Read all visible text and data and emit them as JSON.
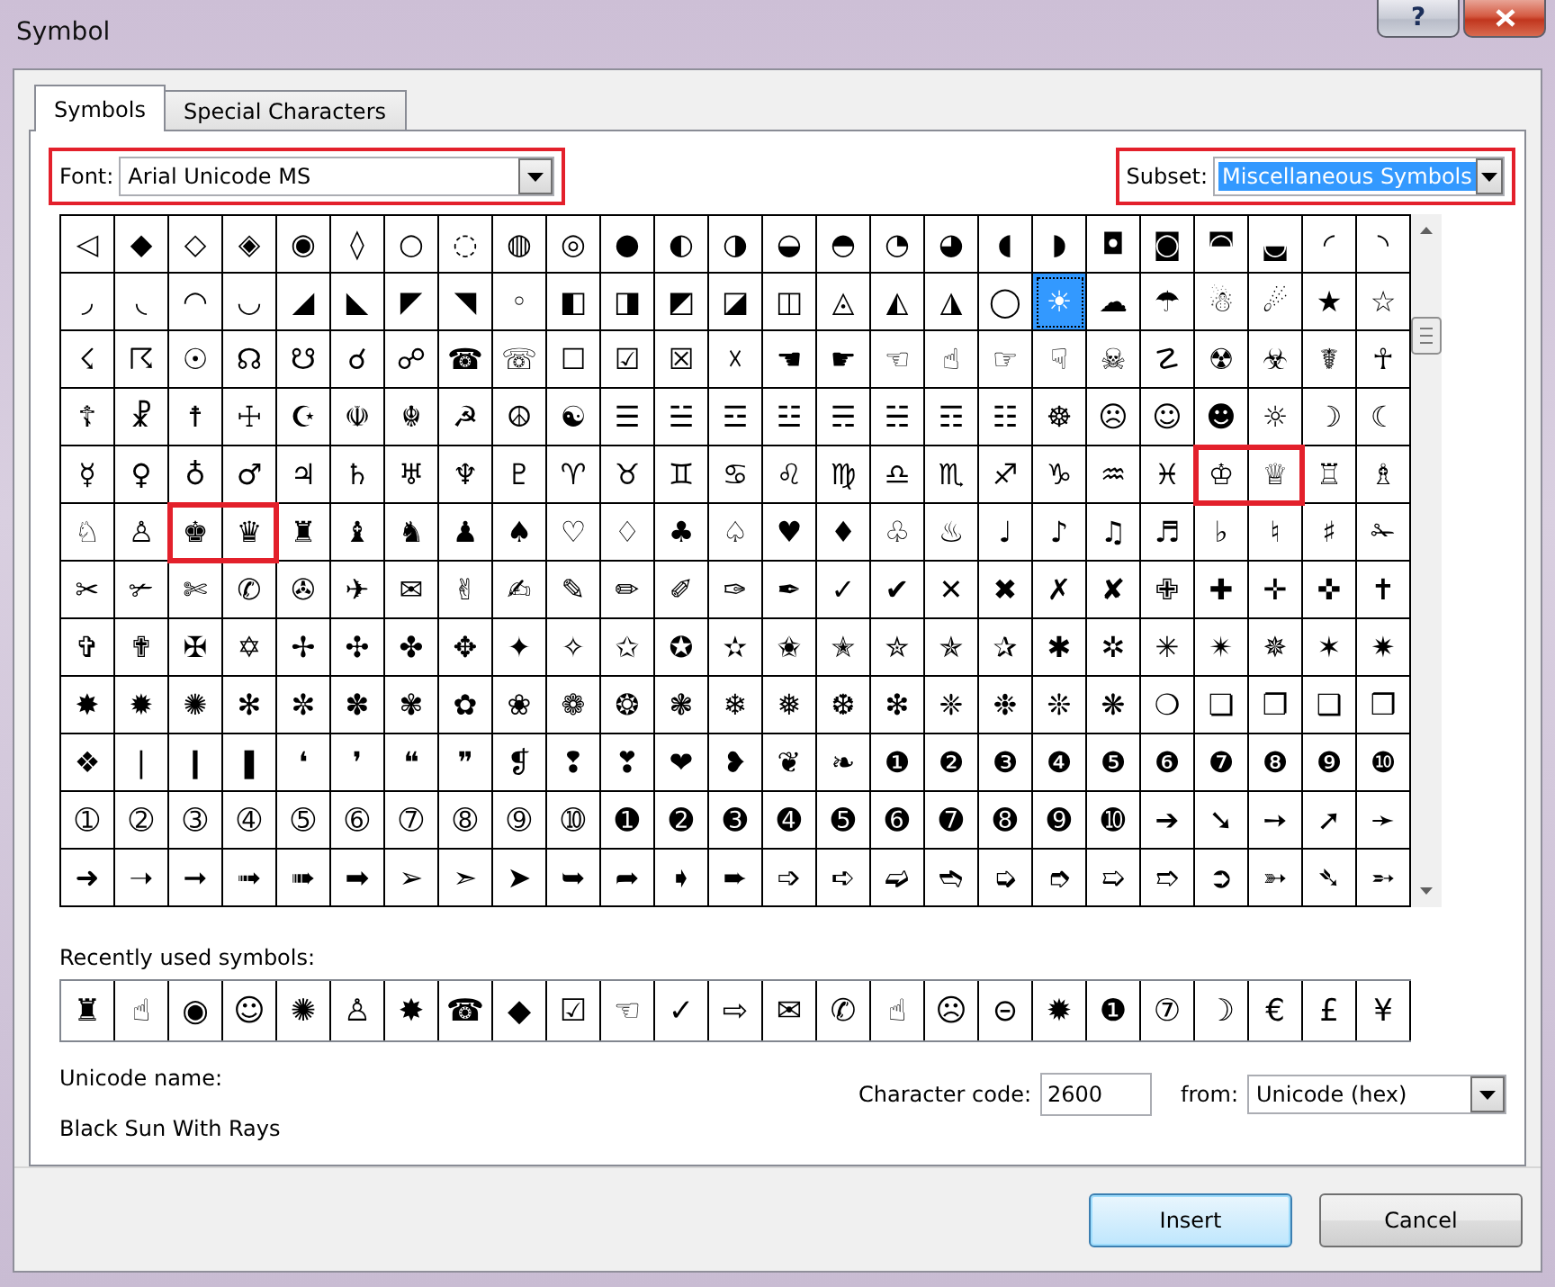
{
  "window": {
    "title": "Symbol",
    "help_button": "?"
  },
  "tabs": [
    {
      "label": "Symbols",
      "selected": true
    },
    {
      "label": "Special Characters",
      "selected": false
    }
  ],
  "font": {
    "label": "Font:",
    "value": "Arial Unicode MS",
    "highlighted": true
  },
  "subset": {
    "label": "Subset:",
    "value": "Miscellaneous Symbols",
    "focused": true,
    "highlighted": true
  },
  "symbol_grid": {
    "rows": [
      {
        "segments": [
          {
            "highlighted": false,
            "cells": [
              {
                "symbol": "◁",
                "selected": false
              },
              {
                "symbol": "◆",
                "selected": false
              },
              {
                "symbol": "◇",
                "selected": false
              },
              {
                "symbol": "◈",
                "selected": false
              },
              {
                "symbol": "◉",
                "selected": false
              },
              {
                "symbol": "◊",
                "selected": false
              },
              {
                "symbol": "○",
                "selected": false
              },
              {
                "symbol": "◌",
                "selected": false
              },
              {
                "symbol": "◍",
                "selected": false
              },
              {
                "symbol": "◎",
                "selected": false
              },
              {
                "symbol": "●",
                "selected": false
              },
              {
                "symbol": "◐",
                "selected": false
              },
              {
                "symbol": "◑",
                "selected": false
              },
              {
                "symbol": "◒",
                "selected": false
              },
              {
                "symbol": "◓",
                "selected": false
              },
              {
                "symbol": "◔",
                "selected": false
              },
              {
                "symbol": "◕",
                "selected": false
              },
              {
                "symbol": "◖",
                "selected": false
              },
              {
                "symbol": "◗",
                "selected": false
              },
              {
                "symbol": "◘",
                "selected": false
              },
              {
                "symbol": "◙",
                "selected": false
              },
              {
                "symbol": "◚",
                "selected": false
              },
              {
                "symbol": "◛",
                "selected": false
              },
              {
                "symbol": "◜",
                "selected": false
              },
              {
                "symbol": "◝",
                "selected": false
              }
            ]
          }
        ]
      },
      {
        "segments": [
          {
            "highlighted": false,
            "cells": [
              {
                "symbol": "◞",
                "selected": false
              },
              {
                "symbol": "◟",
                "selected": false
              },
              {
                "symbol": "◠",
                "selected": false
              },
              {
                "symbol": "◡",
                "selected": false
              },
              {
                "symbol": "◢",
                "selected": false
              },
              {
                "symbol": "◣",
                "selected": false
              },
              {
                "symbol": "◤",
                "selected": false
              },
              {
                "symbol": "◥",
                "selected": false
              },
              {
                "symbol": "◦",
                "selected": false
              },
              {
                "symbol": "◧",
                "selected": false
              },
              {
                "symbol": "◨",
                "selected": false
              },
              {
                "symbol": "◩",
                "selected": false
              },
              {
                "symbol": "◪",
                "selected": false
              },
              {
                "symbol": "◫",
                "selected": false
              },
              {
                "symbol": "◬",
                "selected": false
              },
              {
                "symbol": "◭",
                "selected": false
              },
              {
                "symbol": "◮",
                "selected": false
              },
              {
                "symbol": "◯",
                "selected": false
              },
              {
                "symbol": "☀",
                "selected": true
              },
              {
                "symbol": "☁",
                "selected": false
              },
              {
                "symbol": "☂",
                "selected": false
              },
              {
                "symbol": "☃",
                "selected": false
              },
              {
                "symbol": "☄",
                "selected": false
              },
              {
                "symbol": "★",
                "selected": false
              },
              {
                "symbol": "☆",
                "selected": false
              }
            ]
          }
        ]
      },
      {
        "segments": [
          {
            "highlighted": false,
            "cells": [
              {
                "symbol": "☇",
                "selected": false
              },
              {
                "symbol": "☈",
                "selected": false
              },
              {
                "symbol": "☉",
                "selected": false
              },
              {
                "symbol": "☊",
                "selected": false
              },
              {
                "symbol": "☋",
                "selected": false
              },
              {
                "symbol": "☌",
                "selected": false
              },
              {
                "symbol": "☍",
                "selected": false
              },
              {
                "symbol": "☎",
                "selected": false
              },
              {
                "symbol": "☏",
                "selected": false
              },
              {
                "symbol": "☐",
                "selected": false
              },
              {
                "symbol": "☑",
                "selected": false
              },
              {
                "symbol": "☒",
                "selected": false
              },
              {
                "symbol": "☓",
                "selected": false
              },
              {
                "symbol": "☚",
                "selected": false
              },
              {
                "symbol": "☛",
                "selected": false
              },
              {
                "symbol": "☜",
                "selected": false
              },
              {
                "symbol": "☝",
                "selected": false
              },
              {
                "symbol": "☞",
                "selected": false
              },
              {
                "symbol": "☟",
                "selected": false
              },
              {
                "symbol": "☠",
                "selected": false
              },
              {
                "symbol": "☡",
                "selected": false
              },
              {
                "symbol": "☢",
                "selected": false
              },
              {
                "symbol": "☣",
                "selected": false
              },
              {
                "symbol": "☤",
                "selected": false
              },
              {
                "symbol": "☥",
                "selected": false
              }
            ]
          }
        ]
      },
      {
        "segments": [
          {
            "highlighted": false,
            "cells": [
              {
                "symbol": "☦",
                "selected": false
              },
              {
                "symbol": "☧",
                "selected": false
              },
              {
                "symbol": "☨",
                "selected": false
              },
              {
                "symbol": "☩",
                "selected": false
              },
              {
                "symbol": "☪",
                "selected": false
              },
              {
                "symbol": "☫",
                "selected": false
              },
              {
                "symbol": "☬",
                "selected": false
              },
              {
                "symbol": "☭",
                "selected": false
              },
              {
                "symbol": "☮",
                "selected": false
              },
              {
                "symbol": "☯",
                "selected": false
              },
              {
                "symbol": "☰",
                "selected": false
              },
              {
                "symbol": "☱",
                "selected": false
              },
              {
                "symbol": "☲",
                "selected": false
              },
              {
                "symbol": "☳",
                "selected": false
              },
              {
                "symbol": "☴",
                "selected": false
              },
              {
                "symbol": "☵",
                "selected": false
              },
              {
                "symbol": "☶",
                "selected": false
              },
              {
                "symbol": "☷",
                "selected": false
              },
              {
                "symbol": "☸",
                "selected": false
              },
              {
                "symbol": "☹",
                "selected": false
              },
              {
                "symbol": "☺",
                "selected": false
              },
              {
                "symbol": "☻",
                "selected": false
              },
              {
                "symbol": "☼",
                "selected": false
              },
              {
                "symbol": "☽",
                "selected": false
              },
              {
                "symbol": "☾",
                "selected": false
              }
            ]
          }
        ]
      },
      {
        "segments": [
          {
            "highlighted": false,
            "cells": [
              {
                "symbol": "☿",
                "selected": false
              },
              {
                "symbol": "♀",
                "selected": false
              },
              {
                "symbol": "♁",
                "selected": false
              },
              {
                "symbol": "♂",
                "selected": false
              },
              {
                "symbol": "♃",
                "selected": false
              },
              {
                "symbol": "♄",
                "selected": false
              },
              {
                "symbol": "♅",
                "selected": false
              },
              {
                "symbol": "♆",
                "selected": false
              },
              {
                "symbol": "♇",
                "selected": false
              },
              {
                "symbol": "♈",
                "selected": false
              },
              {
                "symbol": "♉",
                "selected": false
              },
              {
                "symbol": "♊",
                "selected": false
              },
              {
                "symbol": "♋",
                "selected": false
              },
              {
                "symbol": "♌",
                "selected": false
              },
              {
                "symbol": "♍",
                "selected": false
              },
              {
                "symbol": "♎",
                "selected": false
              },
              {
                "symbol": "♏",
                "selected": false
              },
              {
                "symbol": "♐",
                "selected": false
              },
              {
                "symbol": "♑",
                "selected": false
              },
              {
                "symbol": "♒",
                "selected": false
              },
              {
                "symbol": "♓",
                "selected": false
              }
            ]
          },
          {
            "highlighted": true,
            "cells": [
              {
                "symbol": "♔",
                "selected": false
              },
              {
                "symbol": "♕",
                "selected": false
              }
            ]
          },
          {
            "highlighted": false,
            "cells": [
              {
                "symbol": "♖",
                "selected": false
              },
              {
                "symbol": "♗",
                "selected": false
              }
            ]
          }
        ]
      },
      {
        "segments": [
          {
            "highlighted": false,
            "cells": [
              {
                "symbol": "♘",
                "selected": false
              },
              {
                "symbol": "♙",
                "selected": false
              }
            ]
          },
          {
            "highlighted": true,
            "cells": [
              {
                "symbol": "♚",
                "selected": false
              },
              {
                "symbol": "♛",
                "selected": false
              }
            ]
          },
          {
            "highlighted": false,
            "cells": [
              {
                "symbol": "♜",
                "selected": false
              },
              {
                "symbol": "♝",
                "selected": false
              },
              {
                "symbol": "♞",
                "selected": false
              },
              {
                "symbol": "♟",
                "selected": false
              },
              {
                "symbol": "♠",
                "selected": false
              },
              {
                "symbol": "♡",
                "selected": false
              },
              {
                "symbol": "♢",
                "selected": false
              },
              {
                "symbol": "♣",
                "selected": false
              },
              {
                "symbol": "♤",
                "selected": false
              },
              {
                "symbol": "♥",
                "selected": false
              },
              {
                "symbol": "♦",
                "selected": false
              },
              {
                "symbol": "♧",
                "selected": false
              },
              {
                "symbol": "♨",
                "selected": false
              },
              {
                "symbol": "♩",
                "selected": false
              },
              {
                "symbol": "♪",
                "selected": false
              },
              {
                "symbol": "♫",
                "selected": false
              },
              {
                "symbol": "♬",
                "selected": false
              },
              {
                "symbol": "♭",
                "selected": false
              },
              {
                "symbol": "♮",
                "selected": false
              },
              {
                "symbol": "♯",
                "selected": false
              },
              {
                "symbol": "✁",
                "selected": false
              }
            ]
          }
        ]
      },
      {
        "segments": [
          {
            "highlighted": false,
            "cells": [
              {
                "symbol": "✂",
                "selected": false
              },
              {
                "symbol": "✃",
                "selected": false
              },
              {
                "symbol": "✄",
                "selected": false
              },
              {
                "symbol": "✆",
                "selected": false
              },
              {
                "symbol": "✇",
                "selected": false
              },
              {
                "symbol": "✈",
                "selected": false
              },
              {
                "symbol": "✉",
                "selected": false
              },
              {
                "symbol": "✌",
                "selected": false
              },
              {
                "symbol": "✍",
                "selected": false
              },
              {
                "symbol": "✎",
                "selected": false
              },
              {
                "symbol": "✏",
                "selected": false
              },
              {
                "symbol": "✐",
                "selected": false
              },
              {
                "symbol": "✑",
                "selected": false
              },
              {
                "symbol": "✒",
                "selected": false
              },
              {
                "symbol": "✓",
                "selected": false
              },
              {
                "symbol": "✔",
                "selected": false
              },
              {
                "symbol": "✕",
                "selected": false
              },
              {
                "symbol": "✖",
                "selected": false
              },
              {
                "symbol": "✗",
                "selected": false
              },
              {
                "symbol": "✘",
                "selected": false
              },
              {
                "symbol": "✙",
                "selected": false
              },
              {
                "symbol": "✚",
                "selected": false
              },
              {
                "symbol": "✛",
                "selected": false
              },
              {
                "symbol": "✜",
                "selected": false
              },
              {
                "symbol": "✝",
                "selected": false
              }
            ]
          }
        ]
      },
      {
        "segments": [
          {
            "highlighted": false,
            "cells": [
              {
                "symbol": "✞",
                "selected": false
              },
              {
                "symbol": "✟",
                "selected": false
              },
              {
                "symbol": "✠",
                "selected": false
              },
              {
                "symbol": "✡",
                "selected": false
              },
              {
                "symbol": "✢",
                "selected": false
              },
              {
                "symbol": "✣",
                "selected": false
              },
              {
                "symbol": "✤",
                "selected": false
              },
              {
                "symbol": "✥",
                "selected": false
              },
              {
                "symbol": "✦",
                "selected": false
              },
              {
                "symbol": "✧",
                "selected": false
              },
              {
                "symbol": "✩",
                "selected": false
              },
              {
                "symbol": "✪",
                "selected": false
              },
              {
                "symbol": "✫",
                "selected": false
              },
              {
                "symbol": "✬",
                "selected": false
              },
              {
                "symbol": "✭",
                "selected": false
              },
              {
                "symbol": "✮",
                "selected": false
              },
              {
                "symbol": "✯",
                "selected": false
              },
              {
                "symbol": "✰",
                "selected": false
              },
              {
                "symbol": "✱",
                "selected": false
              },
              {
                "symbol": "✲",
                "selected": false
              },
              {
                "symbol": "✳",
                "selected": false
              },
              {
                "symbol": "✴",
                "selected": false
              },
              {
                "symbol": "✵",
                "selected": false
              },
              {
                "symbol": "✶",
                "selected": false
              },
              {
                "symbol": "✷",
                "selected": false
              }
            ]
          }
        ]
      },
      {
        "segments": [
          {
            "highlighted": false,
            "cells": [
              {
                "symbol": "✸",
                "selected": false
              },
              {
                "symbol": "✹",
                "selected": false
              },
              {
                "symbol": "✺",
                "selected": false
              },
              {
                "symbol": "✻",
                "selected": false
              },
              {
                "symbol": "✼",
                "selected": false
              },
              {
                "symbol": "✽",
                "selected": false
              },
              {
                "symbol": "✾",
                "selected": false
              },
              {
                "symbol": "✿",
                "selected": false
              },
              {
                "symbol": "❀",
                "selected": false
              },
              {
                "symbol": "❁",
                "selected": false
              },
              {
                "symbol": "❂",
                "selected": false
              },
              {
                "symbol": "❃",
                "selected": false
              },
              {
                "symbol": "❄",
                "selected": false
              },
              {
                "symbol": "❅",
                "selected": false
              },
              {
                "symbol": "❆",
                "selected": false
              },
              {
                "symbol": "❇",
                "selected": false
              },
              {
                "symbol": "❈",
                "selected": false
              },
              {
                "symbol": "❉",
                "selected": false
              },
              {
                "symbol": "❊",
                "selected": false
              },
              {
                "symbol": "❋",
                "selected": false
              },
              {
                "symbol": "❍",
                "selected": false
              },
              {
                "symbol": "❏",
                "selected": false
              },
              {
                "symbol": "❐",
                "selected": false
              },
              {
                "symbol": "❑",
                "selected": false
              },
              {
                "symbol": "❒",
                "selected": false
              }
            ]
          }
        ]
      },
      {
        "segments": [
          {
            "highlighted": false,
            "cells": [
              {
                "symbol": "❖",
                "selected": false
              },
              {
                "symbol": "❘",
                "selected": false
              },
              {
                "symbol": "❙",
                "selected": false
              },
              {
                "symbol": "❚",
                "selected": false
              },
              {
                "symbol": "❛",
                "selected": false
              },
              {
                "symbol": "❜",
                "selected": false
              },
              {
                "symbol": "❝",
                "selected": false
              },
              {
                "symbol": "❞",
                "selected": false
              },
              {
                "symbol": "❡",
                "selected": false
              },
              {
                "symbol": "❢",
                "selected": false
              },
              {
                "symbol": "❣",
                "selected": false
              },
              {
                "symbol": "❤",
                "selected": false
              },
              {
                "symbol": "❥",
                "selected": false
              },
              {
                "symbol": "❦",
                "selected": false
              },
              {
                "symbol": "❧",
                "selected": false
              },
              {
                "symbol": "❶",
                "selected": false
              },
              {
                "symbol": "❷",
                "selected": false
              },
              {
                "symbol": "❸",
                "selected": false
              },
              {
                "symbol": "❹",
                "selected": false
              },
              {
                "symbol": "❺",
                "selected": false
              },
              {
                "symbol": "❻",
                "selected": false
              },
              {
                "symbol": "❼",
                "selected": false
              },
              {
                "symbol": "❽",
                "selected": false
              },
              {
                "symbol": "❾",
                "selected": false
              },
              {
                "symbol": "❿",
                "selected": false
              }
            ]
          }
        ]
      },
      {
        "segments": [
          {
            "highlighted": false,
            "cells": [
              {
                "symbol": "➀",
                "selected": false
              },
              {
                "symbol": "➁",
                "selected": false
              },
              {
                "symbol": "➂",
                "selected": false
              },
              {
                "symbol": "➃",
                "selected": false
              },
              {
                "symbol": "➄",
                "selected": false
              },
              {
                "symbol": "➅",
                "selected": false
              },
              {
                "symbol": "➆",
                "selected": false
              },
              {
                "symbol": "➇",
                "selected": false
              },
              {
                "symbol": "➈",
                "selected": false
              },
              {
                "symbol": "➉",
                "selected": false
              },
              {
                "symbol": "➊",
                "selected": false
              },
              {
                "symbol": "➋",
                "selected": false
              },
              {
                "symbol": "➌",
                "selected": false
              },
              {
                "symbol": "➍",
                "selected": false
              },
              {
                "symbol": "➎",
                "selected": false
              },
              {
                "symbol": "➏",
                "selected": false
              },
              {
                "symbol": "➐",
                "selected": false
              },
              {
                "symbol": "➑",
                "selected": false
              },
              {
                "symbol": "➒",
                "selected": false
              },
              {
                "symbol": "➓",
                "selected": false
              },
              {
                "symbol": "➔",
                "selected": false
              },
              {
                "symbol": "➘",
                "selected": false
              },
              {
                "symbol": "➙",
                "selected": false
              },
              {
                "symbol": "➚",
                "selected": false
              },
              {
                "symbol": "➛",
                "selected": false
              }
            ]
          }
        ]
      },
      {
        "segments": [
          {
            "highlighted": false,
            "cells": [
              {
                "symbol": "➜",
                "selected": false
              },
              {
                "symbol": "➝",
                "selected": false
              },
              {
                "symbol": "➞",
                "selected": false
              },
              {
                "symbol": "➟",
                "selected": false
              },
              {
                "symbol": "➠",
                "selected": false
              },
              {
                "symbol": "➡",
                "selected": false
              },
              {
                "symbol": "➢",
                "selected": false
              },
              {
                "symbol": "➣",
                "selected": false
              },
              {
                "symbol": "➤",
                "selected": false
              },
              {
                "symbol": "➥",
                "selected": false
              },
              {
                "symbol": "➦",
                "selected": false
              },
              {
                "symbol": "➧",
                "selected": false
              },
              {
                "symbol": "➨",
                "selected": false
              },
              {
                "symbol": "➩",
                "selected": false
              },
              {
                "symbol": "➪",
                "selected": false
              },
              {
                "symbol": "➫",
                "selected": false
              },
              {
                "symbol": "➬",
                "selected": false
              },
              {
                "symbol": "➭",
                "selected": false
              },
              {
                "symbol": "➮",
                "selected": false
              },
              {
                "symbol": "➯",
                "selected": false
              },
              {
                "symbol": "➱",
                "selected": false
              },
              {
                "symbol": "➲",
                "selected": false
              },
              {
                "symbol": "➳",
                "selected": false
              },
              {
                "symbol": "➴",
                "selected": false
              },
              {
                "symbol": "➵",
                "selected": false
              }
            ]
          }
        ]
      }
    ]
  },
  "recently_used": {
    "label": "Recently used symbols:",
    "symbols": [
      "♜",
      "☝",
      "◉",
      "☺",
      "✺",
      "♙",
      "✸",
      "☎",
      "◆",
      "☑",
      "☜",
      "✓",
      "⇨",
      "✉",
      "✆",
      "☝",
      "☹",
      "⊝",
      "✹",
      "❶",
      "⑦",
      "☽",
      "€",
      "£",
      "¥"
    ]
  },
  "unicode_name": {
    "label": "Unicode name:",
    "value": "Black Sun With Rays"
  },
  "character_code": {
    "label": "Character code:",
    "value": "2600"
  },
  "from": {
    "label": "from:",
    "value": "Unicode (hex)"
  },
  "buttons": [
    {
      "label": "Insert",
      "default": true
    },
    {
      "label": "Cancel",
      "default": false
    }
  ]
}
